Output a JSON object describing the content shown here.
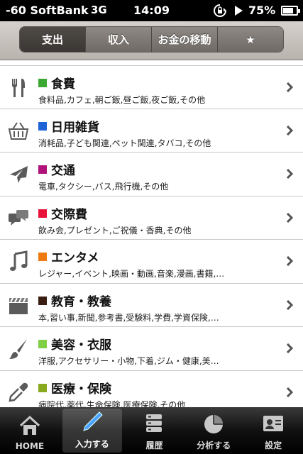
{
  "status_bar": {
    "carrier": "-60 SoftBank",
    "network": "3G",
    "time": "14:09",
    "battery": "75%",
    "battery_level": 0.75
  },
  "segments": [
    {
      "label": "支出",
      "active": true
    },
    {
      "label": "収入",
      "active": false
    },
    {
      "label": "お金の移動",
      "active": false
    },
    {
      "label": "★",
      "active": false
    }
  ],
  "categories": [
    {
      "icon": "fork-knife-icon",
      "color": "#3aa832",
      "title": "食費",
      "subtitle": "食料品,カフェ,朝ご飯,昼ご飯,夜ご飯,その他"
    },
    {
      "icon": "basket-icon",
      "color": "#1e63d6",
      "title": "日用雑貨",
      "subtitle": "消耗品,子ども関連,ペット関連,タバコ,その他"
    },
    {
      "icon": "airplane-icon",
      "color": "#b0127a",
      "title": "交通",
      "subtitle": "電車,タクシー,バス,飛行機,その他"
    },
    {
      "icon": "chat-bubbles-icon",
      "color": "#e8123a",
      "title": "交際費",
      "subtitle": "飲み会,プレゼント,ご祝儀・香典,その他"
    },
    {
      "icon": "music-note-icon",
      "color": "#f07a12",
      "title": "エンタメ",
      "subtitle": "レジャー,イベント,映画・動画,音楽,漫画,書籍,…"
    },
    {
      "icon": "clapperboard-icon",
      "color": "#3a1e12",
      "title": "教育・教養",
      "subtitle": "本,習い事,新聞,参考書,受験料,学費,学資保険,…"
    },
    {
      "icon": "brush-icon",
      "color": "#7fd044",
      "title": "美容・衣服",
      "subtitle": "洋服,アクセサリー・小物,下着,ジム・健康,美…"
    },
    {
      "icon": "dropper-icon",
      "color": "#88a81e",
      "title": "医療・保険",
      "subtitle": "病院代,薬代,生命保険,医療保険,その他"
    }
  ],
  "tabs": [
    {
      "icon": "home-icon",
      "label": "HOME",
      "active": false
    },
    {
      "icon": "pen-icon",
      "label": "入力する",
      "active": true
    },
    {
      "icon": "history-icon",
      "label": "履歴",
      "active": false
    },
    {
      "icon": "pie-chart-icon",
      "label": "分析する",
      "active": false
    },
    {
      "icon": "settings-card-icon",
      "label": "設定",
      "active": false
    }
  ]
}
